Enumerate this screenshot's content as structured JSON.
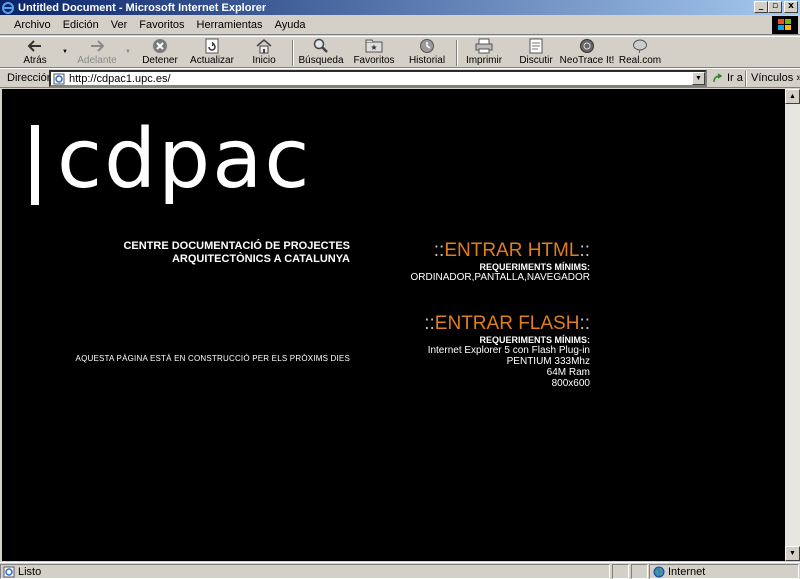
{
  "window": {
    "title": "Untitled Document - Microsoft Internet Explorer",
    "controls": [
      "_",
      "▫",
      "x"
    ]
  },
  "menu": [
    "Archivo",
    "Edición",
    "Ver",
    "Favoritos",
    "Herramientas",
    "Ayuda"
  ],
  "toolbar": {
    "back": "Atrás",
    "forward": "Adelante",
    "stop": "Detener",
    "refresh": "Actualizar",
    "home": "Inicio",
    "search": "Búsqueda",
    "favorites": "Favoritos",
    "history": "Historial",
    "print": "Imprimir",
    "discuss": "Discutir",
    "neotrace": "NeoTrace It!",
    "realcom": "Real.com"
  },
  "address": {
    "label": "Dirección",
    "url": "http://cdpac1.upc.es/",
    "go": "Ir a",
    "links": "Vínculos"
  },
  "page": {
    "logo": "cdpac",
    "centre_title": "CENTRE DOCUMENTACIÓ DE PROJECTES ARQUITECTÒNICS A CATALUNYA",
    "construction": "AQUESTA PÀGINA ESTÀ EN CONSTRUCCIÓ PER ELS PRÒXIMS DIES",
    "html_entry": {
      "prefix": "::",
      "label": "ENTRAR HTML",
      "suffix": "::",
      "req_title": "REQUERIMENTS MÍNIMS:",
      "req_lines": [
        "ORDINADOR,PANTALLA,NAVEGADOR"
      ]
    },
    "flash_entry": {
      "prefix": "::",
      "label": "ENTRAR FLASH",
      "suffix": "::",
      "req_title": "REQUERIMENTS MÍNIMS:",
      "req_lines": [
        "Internet Explorer 5 con Flash Plug-in",
        "PENTIUM 333Mhz",
        "64M Ram",
        "800x600"
      ]
    }
  },
  "status": {
    "text": "Listo",
    "zone": "Internet"
  },
  "colors": {
    "accent": "#e07f1c",
    "titlebar_start": "#0a246a",
    "titlebar_end": "#a6caf0"
  }
}
